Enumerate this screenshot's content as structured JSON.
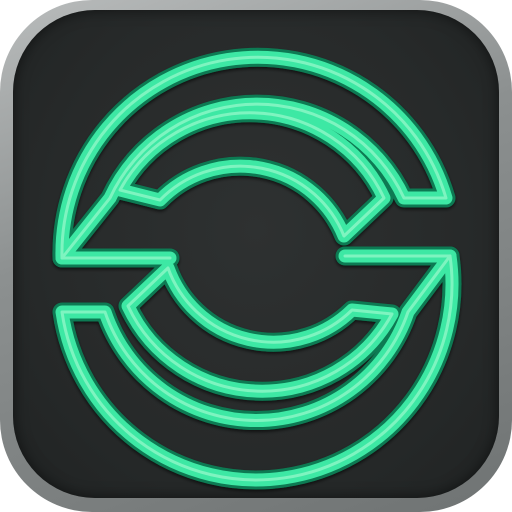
{
  "app_icon": {
    "icon": "circular-s-maze-logo-icon",
    "colors": {
      "frame_outer": "#8c9090",
      "face": "#2a2d2d",
      "logo_green": "#3ee8a4",
      "logo_green_highlight": "#8ff7c8",
      "logo_green_shadow": "#0f7a52"
    }
  }
}
